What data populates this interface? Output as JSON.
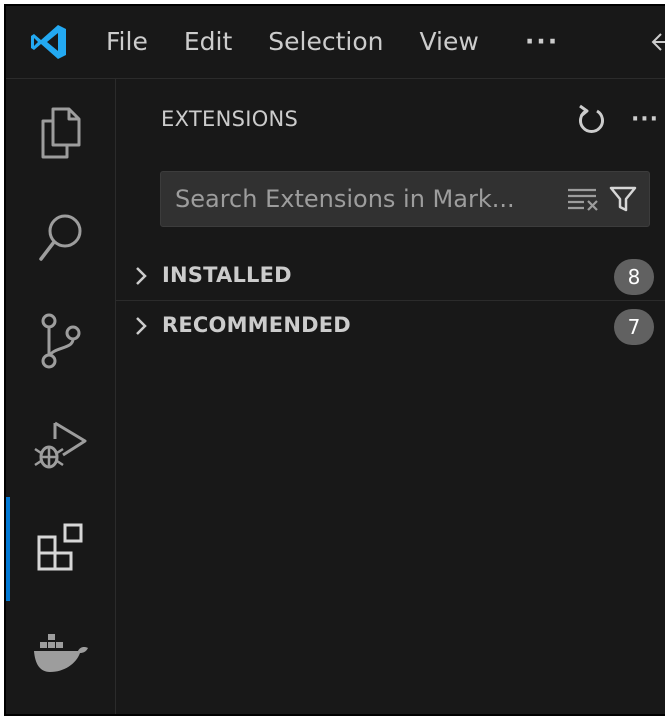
{
  "menu": {
    "file": "File",
    "edit": "Edit",
    "selection": "Selection",
    "view": "View",
    "more": "···"
  },
  "activity_bar": {
    "items": [
      {
        "icon": "explorer-icon"
      },
      {
        "icon": "search-icon"
      },
      {
        "icon": "source-control-icon"
      },
      {
        "icon": "run-debug-icon"
      },
      {
        "icon": "extensions-icon",
        "active": true
      },
      {
        "icon": "docker-icon"
      }
    ]
  },
  "sidebar": {
    "title": "EXTENSIONS",
    "more": "···",
    "search": {
      "placeholder": "Search Extensions in Mark..."
    },
    "sections": {
      "installed": {
        "label": "INSTALLED",
        "count": "8"
      },
      "recommended": {
        "label": "RECOMMENDED",
        "count": "7"
      }
    }
  },
  "colors": {
    "background": "#181818",
    "text": "#cccccc",
    "accent": "#0078d4",
    "logo": "#23a9f2",
    "badge": "#616161"
  }
}
